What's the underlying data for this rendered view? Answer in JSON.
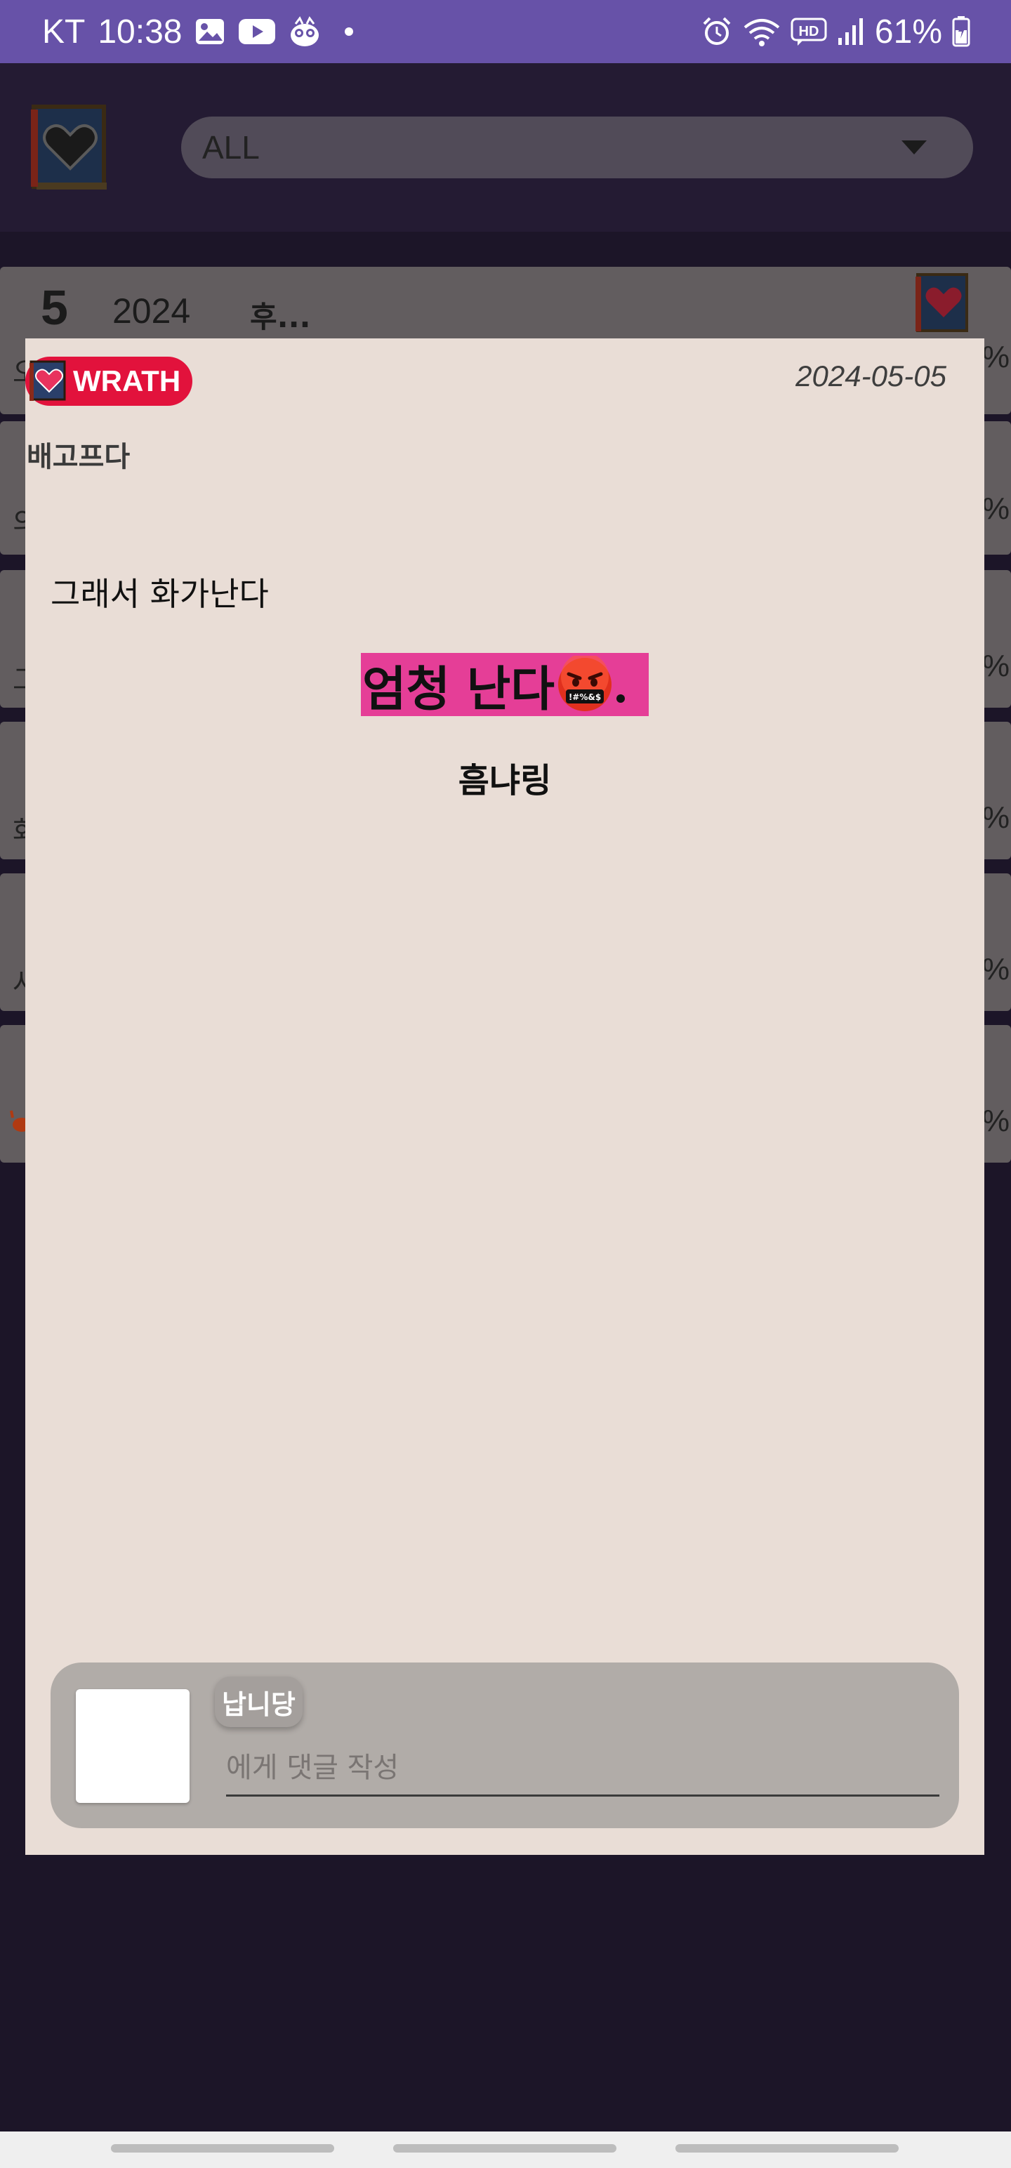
{
  "status_bar": {
    "carrier": "KT",
    "time": "10:38",
    "battery": "61%",
    "notification_icons": [
      "gallery-icon",
      "youtube-icon",
      "app-mascot-icon"
    ],
    "system_icons": [
      "alarm-icon",
      "wifi-icon",
      "hd-call-icon",
      "signal-icon",
      "battery-icon"
    ]
  },
  "header": {
    "filter": {
      "selected": "ALL"
    }
  },
  "background_list": {
    "first_card": {
      "number": "5",
      "year": "2024",
      "title": "후..."
    },
    "percent_symbol": "%",
    "leading_chars": [
      "오",
      "의",
      "그",
      "화",
      "사"
    ]
  },
  "dialog": {
    "category": "WRATH",
    "date": "2024-05-05",
    "title": "배고프다",
    "body": {
      "line1": "그래서 화가난다",
      "line2": "엄청 난다",
      "line3": "흠냐링"
    },
    "comment": {
      "nickname": "납니당",
      "placeholder": "에게 댓글 작성"
    }
  },
  "colors": {
    "status_bar": "#6752a8",
    "app_background": "#1c1528",
    "dialog_background": "#e9ddd6",
    "wrath_badge": "#e2123c",
    "highlight": "#e53e97",
    "comment_box": "#b1aca8"
  }
}
